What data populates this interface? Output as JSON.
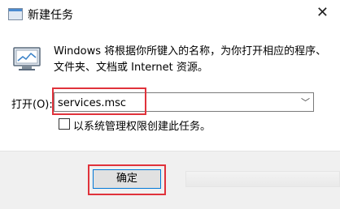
{
  "window": {
    "title": "新建任务",
    "close_glyph": "✕"
  },
  "content": {
    "description": "Windows 将根据你所键入的名称，为你打开相应的程序、文件夹、文档或 Internet 资源。",
    "open_label": "打开(O):",
    "open_value": "services.msc",
    "dropdown_glyph": "﹀",
    "admin_checkbox_label": "以系统管理权限创建此任务。",
    "admin_checked": false
  },
  "footer": {
    "ok_label": "确定"
  },
  "colors": {
    "highlight": "#e0323b",
    "accent": "#0078d7"
  }
}
